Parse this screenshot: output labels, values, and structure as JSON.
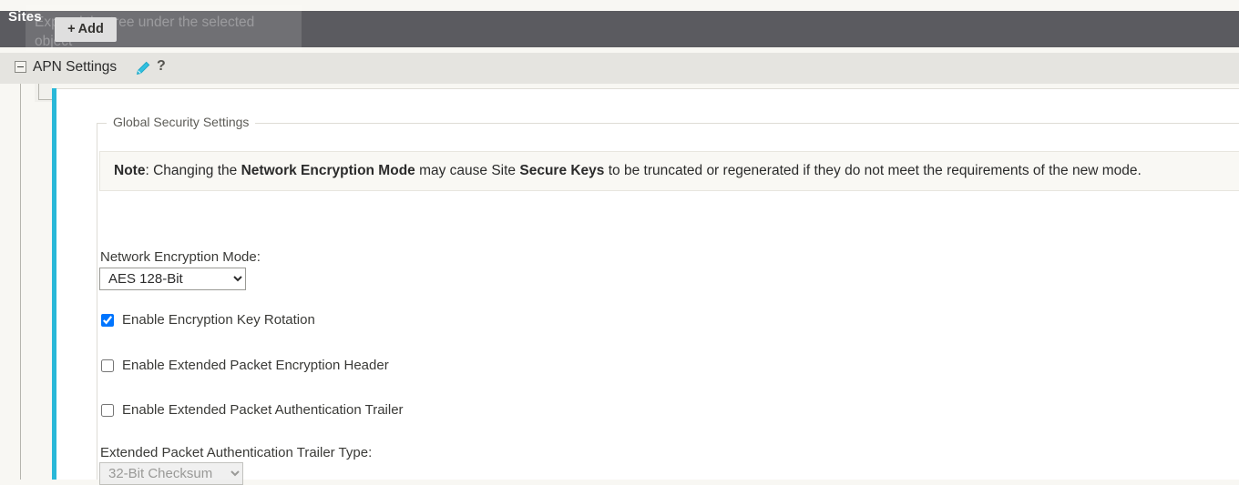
{
  "toolbar": {
    "title": "Sites",
    "add_label": "Add",
    "add_plus": "+",
    "tooltip_text": "Expand the tree under the selected object"
  },
  "tree": {
    "node_label": "APN Settings",
    "edit_icon": "pencil-icon",
    "help_icon": "?",
    "collapse_icon": "minus-box-icon"
  },
  "panel": {
    "legend": "Global Security Settings",
    "note": {
      "prefix_bold": "Note",
      "colon": ":",
      "part1": " Changing the ",
      "bold1": "Network Encryption Mode",
      "part2": " may cause Site ",
      "bold2": "Secure Keys",
      "part3": " to be truncated or regenerated if they do not meet the requirements of the new mode."
    },
    "encryption_mode": {
      "label": "Network Encryption Mode:",
      "value": "AES 128-Bit",
      "options": [
        "AES 128-Bit"
      ]
    },
    "checkboxes": [
      {
        "label": "Enable Encryption Key Rotation",
        "checked": true
      },
      {
        "label": "Enable Extended Packet Encryption Header",
        "checked": false
      },
      {
        "label": "Enable Extended Packet Authentication Trailer",
        "checked": false
      }
    ],
    "trailer_type": {
      "label": "Extended Packet Authentication Trailer Type:",
      "value": "32-Bit Checksum",
      "options": [
        "32-Bit Checksum"
      ],
      "disabled": true
    }
  },
  "colors": {
    "toolbar_bg": "#5b5b60",
    "accent": "#29b8d8",
    "band_bg": "#e5e4e0",
    "page_bg": "#f8f7f3",
    "note_bg": "#f9f8f4"
  }
}
